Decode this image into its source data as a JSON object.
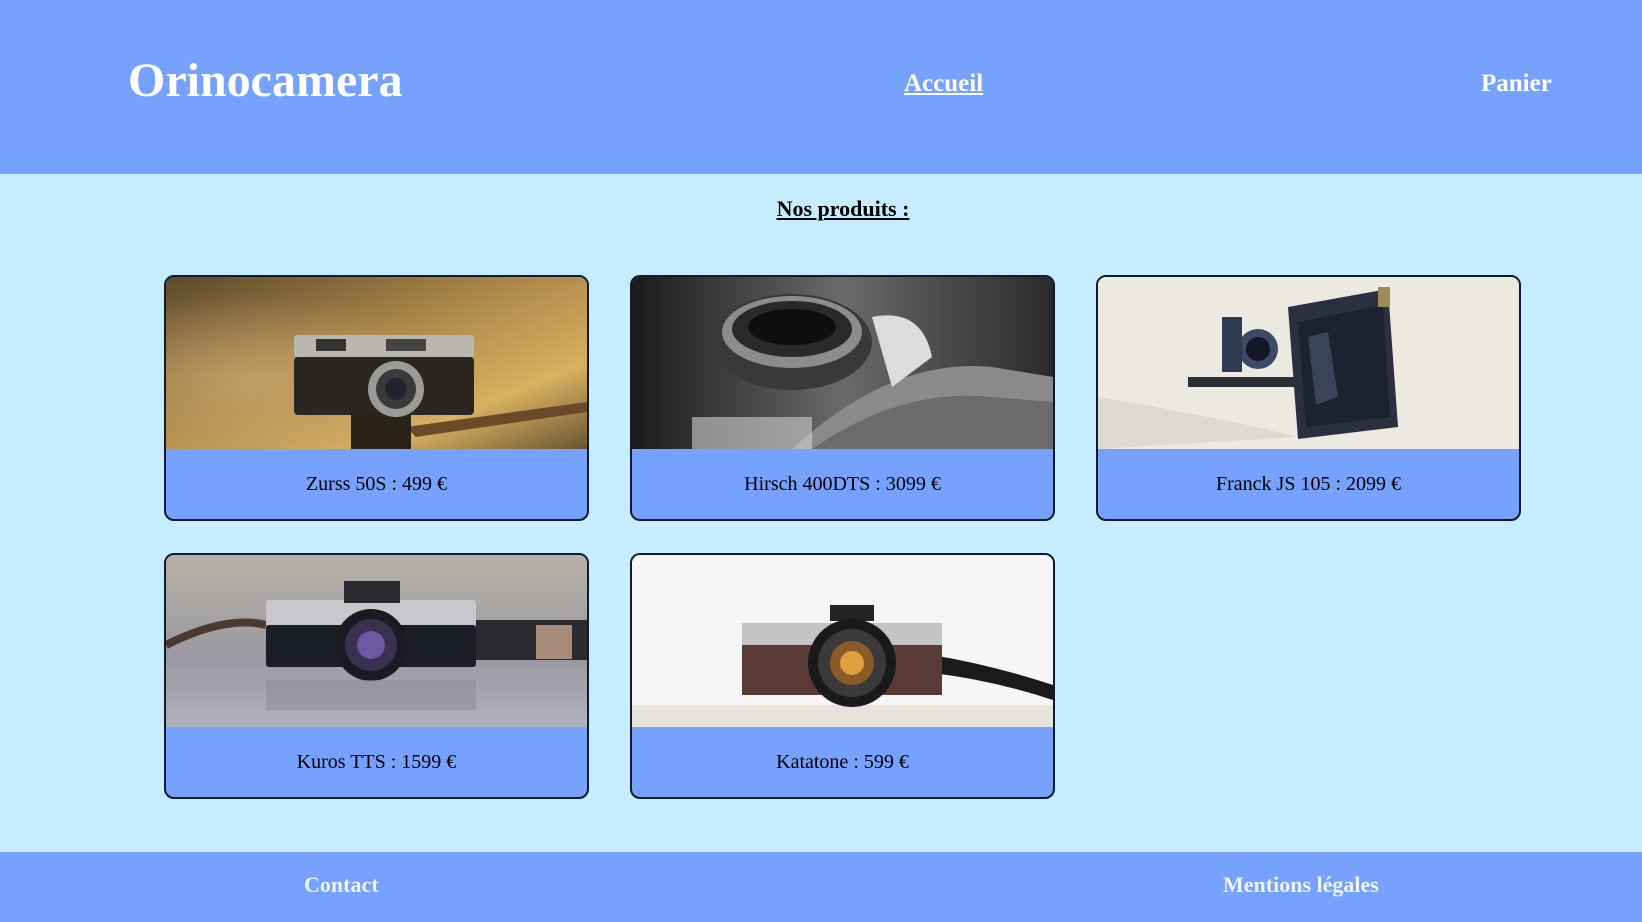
{
  "header": {
    "brand": "Orinocamera",
    "nav": {
      "home": "Accueil",
      "cart": "Panier"
    }
  },
  "main": {
    "section_title": "Nos produits :",
    "products": [
      {
        "caption": "Zurss 50S : 499 €",
        "image": "vintage-rangefinder-camera-photo"
      },
      {
        "caption": "Hirsch 400DTS : 3099 €",
        "image": "black-and-white-camera-lens-photo"
      },
      {
        "caption": "Franck JS 105 : 2099 €",
        "image": "folding-bellows-camera-photo"
      },
      {
        "caption": "Kuros TTS : 1599 €",
        "image": "minolta-slr-camera-photo"
      },
      {
        "caption": "Katatone : 599 €",
        "image": "brown-leather-camera-photo"
      }
    ]
  },
  "footer": {
    "contact": "Contact",
    "legal": "Mentions légales"
  },
  "colors": {
    "header_bg": "#76a1fc",
    "page_bg": "#c8ecff",
    "card_border": "#121a2e",
    "text_light": "#ffffff"
  }
}
